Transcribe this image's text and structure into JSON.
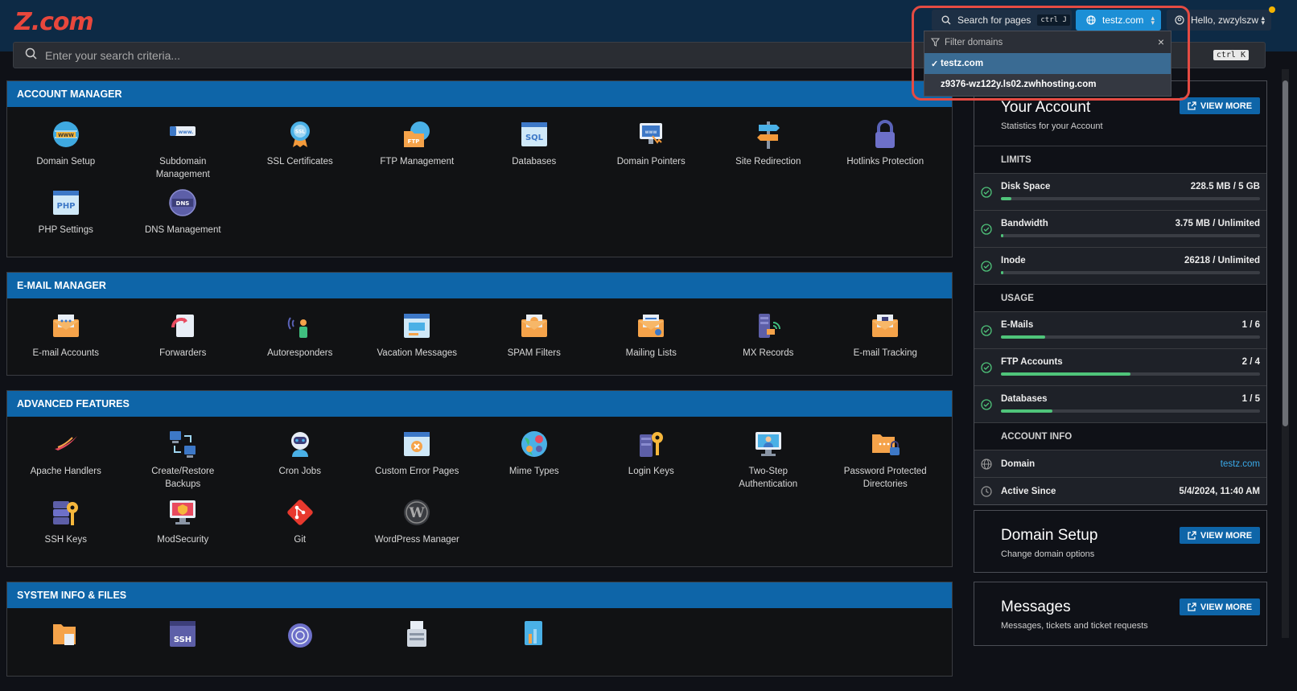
{
  "header": {
    "logo": "Z.com",
    "search_label": "Search for pages",
    "search_kbd": "ctrl J",
    "domain_label": "testz.com",
    "user_label": "Hello, zwzylszw"
  },
  "search": {
    "placeholder": "Enter your search criteria...",
    "kbd": "ctrl K"
  },
  "domain_dropdown": {
    "filter_placeholder": "Filter domains",
    "items": [
      {
        "label": "testz.com",
        "selected": true
      },
      {
        "label": "z9376-wz122y.ls02.zwhhosting.com",
        "selected": false
      }
    ]
  },
  "sections": [
    {
      "title": "ACCOUNT MANAGER",
      "items": [
        {
          "label": "Domain Setup",
          "icon": "globe-www-icon"
        },
        {
          "label": "Subdomain Management",
          "icon": "subdomain-icon"
        },
        {
          "label": "SSL Certificates",
          "icon": "ssl-badge-icon"
        },
        {
          "label": "FTP Management",
          "icon": "ftp-folder-icon"
        },
        {
          "label": "Databases",
          "icon": "sql-icon"
        },
        {
          "label": "Domain Pointers",
          "icon": "monitor-www-icon"
        },
        {
          "label": "Site Redirection",
          "icon": "signpost-icon"
        },
        {
          "label": "Hotlinks Protection",
          "icon": "padlock-icon"
        },
        {
          "label": "PHP Settings",
          "icon": "php-icon"
        },
        {
          "label": "DNS Management",
          "icon": "dns-globe-icon"
        }
      ]
    },
    {
      "title": "E-MAIL MANAGER",
      "items": [
        {
          "label": "E-mail Accounts",
          "icon": "envelope-icon"
        },
        {
          "label": "Forwarders",
          "icon": "forward-doc-icon"
        },
        {
          "label": "Autoresponders",
          "icon": "auto-reply-icon"
        },
        {
          "label": "Vacation Messages",
          "icon": "message-window-icon"
        },
        {
          "label": "SPAM Filters",
          "icon": "spam-envelope-icon"
        },
        {
          "label": "Mailing Lists",
          "icon": "mail-list-icon"
        },
        {
          "label": "MX Records",
          "icon": "mx-server-icon"
        },
        {
          "label": "E-mail Tracking",
          "icon": "mail-tracking-icon"
        }
      ]
    },
    {
      "title": "ADVANCED FEATURES",
      "items": [
        {
          "label": "Apache Handlers",
          "icon": "apache-feather-icon"
        },
        {
          "label": "Create/Restore Backups",
          "icon": "backup-icon"
        },
        {
          "label": "Cron Jobs",
          "icon": "robot-icon"
        },
        {
          "label": "Custom Error Pages",
          "icon": "error-page-icon"
        },
        {
          "label": "Mime Types",
          "icon": "mime-globe-icon"
        },
        {
          "label": "Login Keys",
          "icon": "login-key-icon"
        },
        {
          "label": "Two-Step Authentication",
          "icon": "two-step-icon"
        },
        {
          "label": "Password Protected Directories",
          "icon": "locked-folder-icon"
        },
        {
          "label": "SSH Keys",
          "icon": "ssh-key-icon"
        },
        {
          "label": "ModSecurity",
          "icon": "modsecurity-icon"
        },
        {
          "label": "Git",
          "icon": "git-icon"
        },
        {
          "label": "WordPress Manager",
          "icon": "wordpress-icon"
        }
      ]
    },
    {
      "title": "SYSTEM INFO & FILES",
      "items": [
        {
          "label": "",
          "icon": "file-folder-icon"
        },
        {
          "label": "",
          "icon": "ssh-terminal-icon"
        },
        {
          "label": "",
          "icon": "onion-icon"
        },
        {
          "label": "",
          "icon": "printer-server-icon"
        },
        {
          "label": "",
          "icon": "stats-doc-icon"
        }
      ]
    }
  ],
  "account_card": {
    "title": "Your Account",
    "subtitle": "Statistics for your Account",
    "view_more": "VIEW MORE",
    "limits_title": "LIMITS",
    "limits": [
      {
        "name": "Disk Space",
        "value": "228.5 MB / 5 GB",
        "fraction": 0.04
      },
      {
        "name": "Bandwidth",
        "value": "3.75 MB / Unlimited",
        "fraction": 0.01
      },
      {
        "name": "Inode",
        "value": "26218 / Unlimited",
        "fraction": 0.01
      }
    ],
    "usage_title": "USAGE",
    "usage": [
      {
        "name": "E-Mails",
        "value": "1 / 6",
        "fraction": 0.17
      },
      {
        "name": "FTP Accounts",
        "value": "2 / 4",
        "fraction": 0.5
      },
      {
        "name": "Databases",
        "value": "1 / 5",
        "fraction": 0.2
      }
    ],
    "info_title": "ACCOUNT INFO",
    "info": [
      {
        "name": "Domain",
        "value": "testz.com",
        "icon": "globe-icon"
      },
      {
        "name": "Active Since",
        "value": "5/4/2024, 11:40 AM",
        "icon": "clock-icon"
      }
    ]
  },
  "domain_card": {
    "title": "Domain Setup",
    "subtitle": "Change domain options",
    "view_more": "VIEW MORE"
  },
  "messages_card": {
    "title": "Messages",
    "subtitle": "Messages, tickets and ticket requests",
    "view_more": "VIEW MORE"
  },
  "colors": {
    "accent": "#0e65a8",
    "brand": "#e8473c",
    "success": "#4fc47a",
    "highlight": "#e44b43"
  }
}
